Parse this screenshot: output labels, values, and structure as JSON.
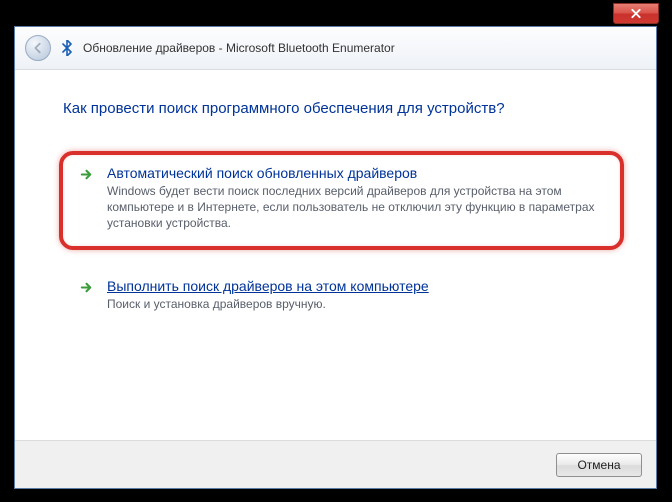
{
  "header": {
    "title": "Обновление драйверов - Microsoft Bluetooth Enumerator"
  },
  "heading": "Как провести поиск программного обеспечения для устройств?",
  "options": [
    {
      "title": "Автоматический поиск обновленных драйверов",
      "desc": "Windows будет вести поиск последних версий драйверов для устройства на этом компьютере и в Интернете, если пользователь не отключил эту функцию в параметрах установки устройства."
    },
    {
      "title": "Выполнить поиск драйверов на этом компьютере",
      "desc": "Поиск и установка драйверов вручную."
    }
  ],
  "footer": {
    "cancel": "Отмена"
  }
}
